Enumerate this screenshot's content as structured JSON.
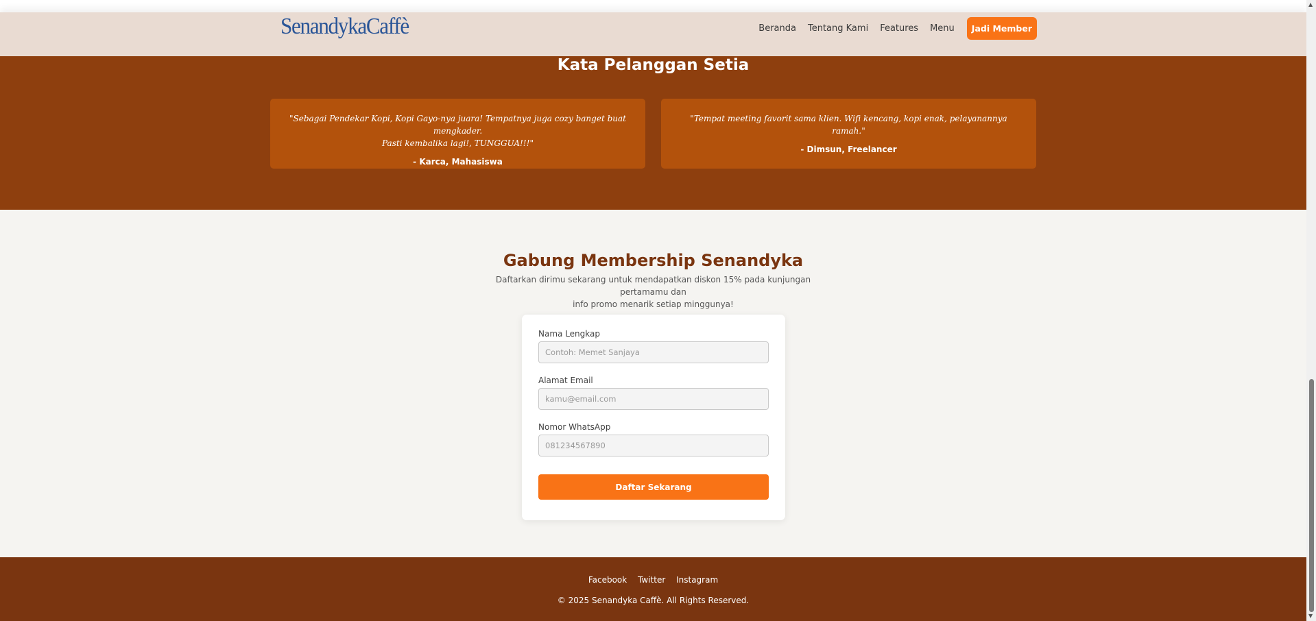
{
  "brand": {
    "logo_text": "SenandykaCaffè"
  },
  "nav": {
    "items": [
      {
        "label": "Beranda"
      },
      {
        "label": "Tentang Kami"
      },
      {
        "label": "Features"
      },
      {
        "label": "Menu"
      }
    ],
    "cta_label": "Jadi Member"
  },
  "testimonials": {
    "title": "Kata Pelanggan Setia",
    "cards": [
      {
        "quote_line1": "\"Sebagai Pendekar Kopi, Kopi Gayo-nya juara! Tempatnya juga cozy banget buat mengkader.",
        "quote_line2": "Pasti kembalika lagi!, TUNGGUA!!!\"",
        "author": "- Karca, Mahasiswa"
      },
      {
        "quote_line1": "\"Tempat meeting favorit sama klien. Wifi kencang, kopi enak, pelayanannya ramah.\"",
        "quote_line2": "",
        "author": "- Dimsun, Freelancer"
      }
    ]
  },
  "membership": {
    "title": "Gabung Membership Senandyka",
    "desc_line1": "Daftarkan dirimu sekarang untuk mendapatkan diskon 15% pada kunjungan pertamamu dan",
    "desc_line2": "info promo menarik setiap minggunya!",
    "form": {
      "name_label": "Nama Lengkap",
      "name_placeholder": "Contoh: Memet Sanjaya",
      "email_label": "Alamat Email",
      "email_placeholder": "kamu@email.com",
      "wa_label": "Nomor WhatsApp",
      "wa_placeholder": "081234567890",
      "submit_label": "Daftar Sekarang"
    }
  },
  "footer": {
    "links": [
      {
        "label": "Facebook"
      },
      {
        "label": "Twitter"
      },
      {
        "label": "Instagram"
      }
    ],
    "copyright": "© 2025 Senandyka Caffè. All Rights Reserved."
  },
  "colors": {
    "brand_blue": "#2a5597",
    "accent_orange": "#f97316",
    "brown": "#8e3f0e",
    "dark_brown": "#7a3510"
  }
}
